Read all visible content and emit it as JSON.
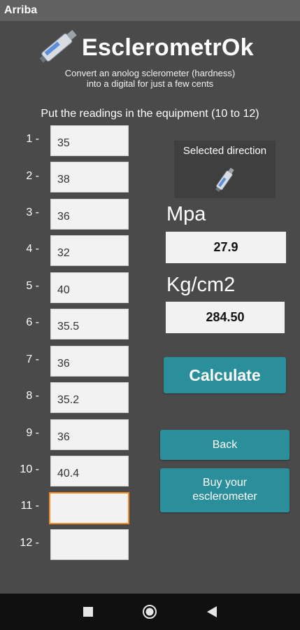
{
  "window": {
    "title": "Arriba"
  },
  "header": {
    "app_name": "EsclerometrOk",
    "subtitle_line1": "Convert an anolog sclerometer (hardness)",
    "subtitle_line2": "into a digital for just a few cents",
    "logo_icon": "sclerometer-icon"
  },
  "instructions": "Put the readings in the equipment (10 to 12)",
  "readings": [
    {
      "label": "1 -",
      "value": "35"
    },
    {
      "label": "2 -",
      "value": "38"
    },
    {
      "label": "3 -",
      "value": "36"
    },
    {
      "label": "4 -",
      "value": "32"
    },
    {
      "label": "5 -",
      "value": "40"
    },
    {
      "label": "6 -",
      "value": "35.5"
    },
    {
      "label": "7 -",
      "value": "36"
    },
    {
      "label": "8 -",
      "value": "35.2"
    },
    {
      "label": "9 -",
      "value": "36"
    },
    {
      "label": "10 -",
      "value": "40.4"
    },
    {
      "label": "11 -",
      "value": ""
    },
    {
      "label": "12 -",
      "value": ""
    }
  ],
  "direction": {
    "label": "Selected direction",
    "icon": "sclerometer-icon"
  },
  "results": {
    "mpa_label": "Mpa",
    "mpa_value": "27.9",
    "kg_label": "Kg/cm2",
    "kg_value": "284.50"
  },
  "buttons": {
    "calculate": "Calculate",
    "back": "Back",
    "buy_line1": "Buy your",
    "buy_line2": "esclerometer"
  },
  "navbar": {
    "icons": [
      "recents-square-icon",
      "home-circle-icon",
      "back-triangle-icon"
    ]
  },
  "colors": {
    "background": "#4a4a4a",
    "accent": "#2b8f9b",
    "focus": "#f08a24"
  }
}
